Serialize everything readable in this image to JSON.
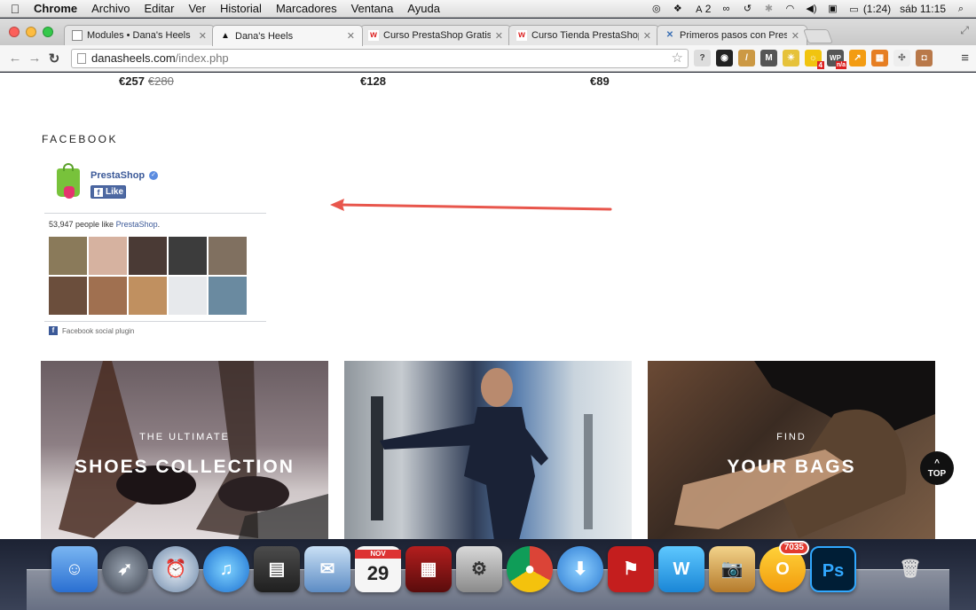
{
  "menubar": {
    "app": "Chrome",
    "items": [
      "Archivo",
      "Editar",
      "Ver",
      "Historial",
      "Marcadores",
      "Ventana",
      "Ayuda"
    ],
    "status": {
      "adobe_count": "2",
      "battery": "(1:24)",
      "clock": "sáb 11:15"
    }
  },
  "browser": {
    "tabs": [
      {
        "label": "Modules • Dana's Heels",
        "icon": "document-icon"
      },
      {
        "label": "Dana's Heels",
        "icon": "heel-icon"
      },
      {
        "label": "Curso PrestaShop Gratis -",
        "icon": "w-icon"
      },
      {
        "label": "Curso Tienda PrestaShop",
        "icon": "w-icon"
      },
      {
        "label": "Primeros pasos con Presta",
        "icon": "x-icon"
      }
    ],
    "url_host": "danasheels.com",
    "url_path": "/index.php",
    "extension_badges": {
      "bulb": "4",
      "wp": "n/a"
    }
  },
  "products": {
    "prices": [
      {
        "price": "€257",
        "old": "€280"
      },
      {
        "price": "€128",
        "old": ""
      },
      {
        "price": "€89",
        "old": ""
      }
    ]
  },
  "facebook": {
    "heading": "FACEBOOK",
    "page_name": "PrestaShop",
    "like_label": "Like",
    "count_text": "53,947 people like ",
    "count_link": "PrestaShop",
    "count_suffix": ".",
    "plugin_label": "Facebook social plugin",
    "face_colors": [
      "#8a7a5a",
      "#d6b2a0",
      "#4a3a35",
      "#3c3c3c",
      "#807060",
      "#6b4e3c",
      "#a07050",
      "#c09060",
      "#e7e9ec",
      "#6a8aa0"
    ]
  },
  "banners": [
    {
      "kicker": "THE ULTIMATE",
      "title": "SHOES COLLECTION"
    },
    {
      "kicker": "",
      "title": ""
    },
    {
      "kicker": "FIND",
      "title": "YOUR BAGS"
    }
  ],
  "top_button": {
    "arrow": "^",
    "label": "TOP"
  },
  "dock": {
    "calendar_month": "NOV",
    "calendar_day": "29",
    "badge_count": "7035",
    "ps_label": "Ps",
    "w_label": "W"
  }
}
